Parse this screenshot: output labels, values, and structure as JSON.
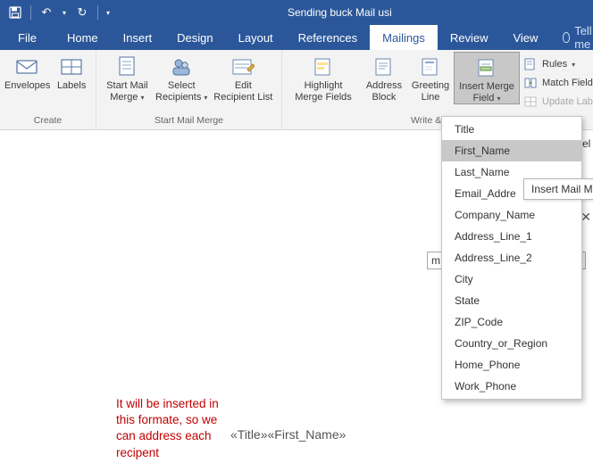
{
  "title": "Sending buck Mail usi",
  "qat": {
    "save": "save-icon",
    "undo": "↶",
    "redo": "↻"
  },
  "tabs": {
    "file": "File",
    "items": [
      "Home",
      "Insert",
      "Design",
      "Layout",
      "References",
      "Mailings",
      "Review",
      "View"
    ],
    "active": "Mailings",
    "tellme": "Tell me"
  },
  "ribbon": {
    "groups": [
      {
        "label": "Create",
        "buttons": [
          {
            "name": "envelopes",
            "label": "Envelopes"
          },
          {
            "name": "labels",
            "label": "Labels"
          }
        ]
      },
      {
        "label": "Start Mail Merge",
        "buttons": [
          {
            "name": "start-mail-merge",
            "label": "Start Mail\nMerge",
            "caret": true
          },
          {
            "name": "select-recipients",
            "label": "Select\nRecipients",
            "caret": true
          },
          {
            "name": "edit-recipient-list",
            "label": "Edit\nRecipient List"
          }
        ]
      },
      {
        "label": "Write & I",
        "buttons": [
          {
            "name": "highlight-merge-fields",
            "label": "Highlight\nMerge Fields"
          },
          {
            "name": "address-block",
            "label": "Address\nBlock"
          },
          {
            "name": "greeting-line",
            "label": "Greeting\nLine"
          },
          {
            "name": "insert-merge-field",
            "label": "Insert Merge\nField",
            "caret": true,
            "active": true
          }
        ]
      }
    ],
    "side_buttons": [
      {
        "name": "rules",
        "label": "Rules",
        "caret": true,
        "disabled": false
      },
      {
        "name": "match-fields",
        "label": "Match Fields",
        "disabled": false
      },
      {
        "name": "update-labels",
        "label": "Update Labels",
        "disabled": true
      }
    ]
  },
  "dropdown": {
    "items": [
      "Title",
      "First_Name",
      "Last_Name",
      "Email_Addre",
      "Company_Name",
      "Address_Line_1",
      "Address_Line_2",
      "City",
      "State",
      "ZIP_Code",
      "Country_or_Region",
      "Home_Phone",
      "Work_Phone"
    ],
    "highlighted": "First_Name"
  },
  "tooltip": "Insert Mail Me",
  "behind": {
    "cancel_fragment": "el",
    "select_value": "m"
  },
  "document": {
    "note": "It will be inserted in\nthis formate, so we\ncan address each\nrecipent",
    "merge_preview": "«Title»«First_Name»"
  }
}
